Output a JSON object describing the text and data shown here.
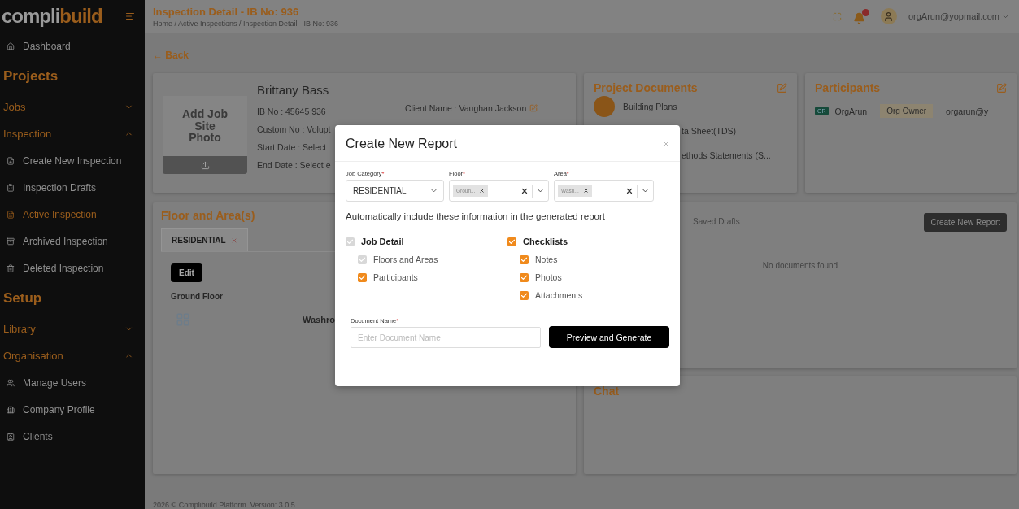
{
  "sidebar": {
    "logo": {
      "first": "compli",
      "second": "build"
    },
    "items": [
      {
        "kind": "link",
        "label": "Dashboard",
        "selected": false
      },
      {
        "kind": "heading",
        "label": "Projects"
      },
      {
        "kind": "group",
        "label": "Jobs",
        "expanded": false
      },
      {
        "kind": "group",
        "label": "Inspection",
        "expanded": true
      },
      {
        "kind": "link",
        "label": "Create New Inspection",
        "selected": false
      },
      {
        "kind": "link",
        "label": "Inspection Drafts",
        "selected": false
      },
      {
        "kind": "link",
        "label": "Active Inspection",
        "selected": true
      },
      {
        "kind": "link",
        "label": "Archived Inspection",
        "selected": false
      },
      {
        "kind": "link",
        "label": "Deleted Inspection",
        "selected": false
      },
      {
        "kind": "heading",
        "label": "Setup"
      },
      {
        "kind": "group",
        "label": "Library",
        "expanded": false
      },
      {
        "kind": "group",
        "label": "Organisation",
        "expanded": true
      },
      {
        "kind": "link",
        "label": "Manage Users",
        "selected": false
      },
      {
        "kind": "link",
        "label": "Company Profile",
        "selected": false
      },
      {
        "kind": "link",
        "label": "Clients",
        "selected": false
      }
    ]
  },
  "header": {
    "title": "Inspection Detail - IB No: 936",
    "breadcrumb": "Home / Active Inspections / Inspection Detail - IB No: 936",
    "user": "orgArun@yopmail.com"
  },
  "back": "← Back",
  "job_card": {
    "photo_label": "Add Job Site Photo",
    "name": "Brittany Bass",
    "fields": [
      {
        "label": "IB No :",
        "value": "45645 936"
      },
      {
        "label": "Custom No :",
        "value": "Volupt"
      },
      {
        "label": "Start Date :",
        "value": "Select"
      },
      {
        "label": "End Date :",
        "value": "Select e"
      }
    ],
    "client": {
      "label": "Client Name :",
      "value": "Vaughan Jackson"
    }
  },
  "project_documents": {
    "title": "Project Documents",
    "items": [
      {
        "name": "Building Plans",
        "icon": true
      },
      {
        "name": "ta Sheet(TDS)",
        "icon": false
      },
      {
        "name": "ethods Statements (S...",
        "icon": false
      }
    ]
  },
  "participants": {
    "title": "Participants",
    "items": [
      {
        "initials": "OR",
        "name": "OrgArun",
        "role": "Org Owner",
        "email": "orgarun@y"
      }
    ]
  },
  "floor_area": {
    "title": "Floor and Area(s)",
    "tabs": [
      {
        "label": "RESIDENTIAL",
        "selected": true
      }
    ],
    "edit_button": "Edit",
    "floors": [
      {
        "name": "Ground Floor",
        "areas": [
          {
            "name": "Washro"
          }
        ]
      }
    ]
  },
  "reports": {
    "tabs": [
      {
        "label": "Saved Drafts",
        "selected": false
      }
    ],
    "create_button": "Create New Report",
    "empty": "No documents found"
  },
  "chat": {
    "title": "Chat"
  },
  "footer": "2026 © Complibuild Platform. Version: 3.0.5",
  "modal": {
    "title": "Create New Report",
    "fields": [
      {
        "kind": "select",
        "label": "Job Category",
        "mark": "*",
        "value": "RESIDENTIAL"
      },
      {
        "kind": "multi",
        "label": "Floor",
        "mark": "*",
        "chips": [
          "Groun..."
        ]
      },
      {
        "kind": "multi",
        "label": "Area",
        "mark": "*",
        "chips": [
          "Wash..."
        ]
      }
    ],
    "heading": "Automatically include these information in the generated report",
    "columns": [
      [
        {
          "label": "Job Detail",
          "checked": true,
          "disabled": true,
          "children": [
            {
              "label": "Floors and Areas",
              "checked": true,
              "disabled": true
            },
            {
              "label": "Participants",
              "checked": true,
              "disabled": false
            }
          ]
        }
      ],
      [
        {
          "label": "Checklists",
          "checked": true,
          "disabled": false,
          "children": [
            {
              "label": "Notes",
              "checked": true,
              "disabled": false
            },
            {
              "label": "Photos",
              "checked": true,
              "disabled": false
            },
            {
              "label": "Attachments",
              "checked": true,
              "disabled": false
            }
          ]
        }
      ]
    ],
    "document_name": {
      "label": "Document Name",
      "mark": "*",
      "placeholder": "Enter Document Name"
    },
    "submit": "Preview and Generate"
  }
}
